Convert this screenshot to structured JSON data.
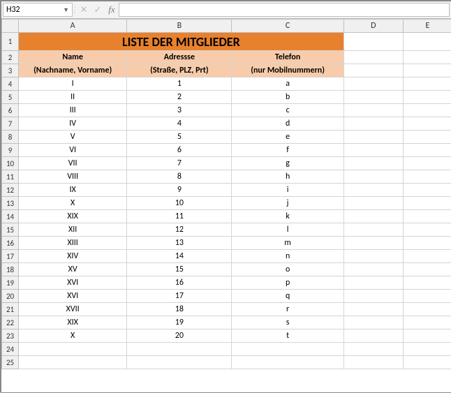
{
  "name_box": "H32",
  "fx_label": "fx",
  "col_headers": [
    "A",
    "B",
    "C",
    "D",
    "E"
  ],
  "row_headers": [
    "1",
    "2",
    "3",
    "4",
    "5",
    "6",
    "7",
    "8",
    "9",
    "10",
    "11",
    "12",
    "13",
    "14",
    "15",
    "16",
    "17",
    "18",
    "19",
    "20",
    "21",
    "22",
    "23",
    "24",
    "25"
  ],
  "title": "LISTE DER MITGLIEDER",
  "headers": {
    "name_l1": "Name",
    "name_l2": "(Nachname, Vorname)",
    "addr_l1": "Adressse",
    "addr_l2": "(Straße, PLZ, Prt)",
    "tel_l1": "Telefon",
    "tel_l2": "(nur Mobilnummern)"
  },
  "rows": [
    {
      "name": "I",
      "addr": "1",
      "tel": "a"
    },
    {
      "name": "II",
      "addr": "2",
      "tel": "b"
    },
    {
      "name": "III",
      "addr": "3",
      "tel": "c"
    },
    {
      "name": "IV",
      "addr": "4",
      "tel": "d"
    },
    {
      "name": "V",
      "addr": "5",
      "tel": "e"
    },
    {
      "name": "VI",
      "addr": "6",
      "tel": "f"
    },
    {
      "name": "VII",
      "addr": "7",
      "tel": "g"
    },
    {
      "name": "VIII",
      "addr": "8",
      "tel": "h"
    },
    {
      "name": "IX",
      "addr": "9",
      "tel": "i"
    },
    {
      "name": "X",
      "addr": "10",
      "tel": "j"
    },
    {
      "name": "XIX",
      "addr": "11",
      "tel": "k"
    },
    {
      "name": "XII",
      "addr": "12",
      "tel": "l"
    },
    {
      "name": "XIII",
      "addr": "13",
      "tel": "m"
    },
    {
      "name": "XIV",
      "addr": "14",
      "tel": "n"
    },
    {
      "name": "XV",
      "addr": "15",
      "tel": "o"
    },
    {
      "name": "XVI",
      "addr": "16",
      "tel": "p"
    },
    {
      "name": "XVI",
      "addr": "17",
      "tel": "q"
    },
    {
      "name": "XVII",
      "addr": "18",
      "tel": "r"
    },
    {
      "name": "XIX",
      "addr": "19",
      "tel": "s"
    },
    {
      "name": "X",
      "addr": "20",
      "tel": "t"
    }
  ]
}
